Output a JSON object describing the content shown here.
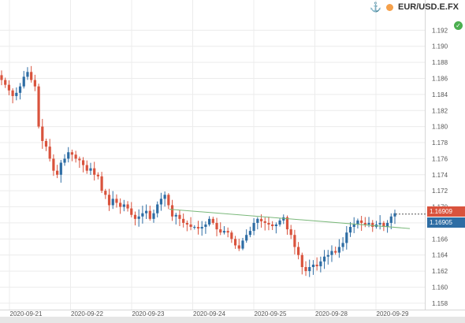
{
  "symbol": "EUR/USD.E.FX",
  "price_tags": {
    "bid": "1.16909",
    "ask": "1.16905"
  },
  "colors": {
    "up": "#2e6da4",
    "down": "#d9533d",
    "trendline": "#7ab87a",
    "grid": "#ececec",
    "status": "#4caf50"
  },
  "icons": {
    "anchor": "⚓",
    "status": "✓"
  },
  "chart_data": {
    "type": "candlestick",
    "x_labels": [
      "2020-09-21",
      "2020-09-22",
      "2020-09-23",
      "2020-09-24",
      "2020-09-25",
      "2020-09-28",
      "2020-09-29"
    ],
    "y_ticks": [
      "1.192",
      "1.190",
      "1.188",
      "1.186",
      "1.184",
      "1.182",
      "1.180",
      "1.178",
      "1.176",
      "1.174",
      "1.172",
      "1.170",
      "1.168",
      "1.166",
      "1.164",
      "1.162",
      "1.160",
      "1.158"
    ],
    "ylim": [
      1.1572,
      1.1938
    ],
    "trendline": {
      "start": 1.1697,
      "end": 1.1673
    },
    "close": [
      1.1858,
      1.1852,
      1.1845,
      1.1838,
      1.1842,
      1.185,
      1.1862,
      1.1868,
      1.1858,
      1.185,
      1.18,
      1.1782,
      1.1775,
      1.176,
      1.1745,
      1.174,
      1.1755,
      1.176,
      1.1768,
      1.1765,
      1.176,
      1.1758,
      1.1752,
      1.1745,
      1.1748,
      1.174,
      1.1738,
      1.172,
      1.1715,
      1.1702,
      1.171,
      1.1705,
      1.17,
      1.1703,
      1.1698,
      1.169,
      1.1685,
      1.1688,
      1.1692,
      1.1695,
      1.1685,
      1.1692,
      1.1703,
      1.171,
      1.1715,
      1.1702,
      1.1688,
      1.169,
      1.1685,
      1.168,
      1.1678,
      1.1675,
      1.1675,
      1.1673,
      1.1675,
      1.1678,
      1.1685,
      1.168,
      1.1672,
      1.1668,
      1.167,
      1.1668,
      1.166,
      1.1652,
      1.1648,
      1.1658,
      1.1665,
      1.167,
      1.168,
      1.1685,
      1.1682,
      1.168,
      1.1678,
      1.1676,
      1.1678,
      1.1683,
      1.1687,
      1.1672,
      1.1665,
      1.165,
      1.164,
      1.1625,
      1.162,
      1.1625,
      1.1628,
      1.1626,
      1.1632,
      1.1638,
      1.164,
      1.1645,
      1.1643,
      1.165,
      1.1655,
      1.1668,
      1.1675,
      1.1678,
      1.1683,
      1.168,
      1.1678,
      1.168,
      1.1675,
      1.1678,
      1.168,
      1.1675,
      1.168,
      1.1688,
      1.1692
    ]
  }
}
